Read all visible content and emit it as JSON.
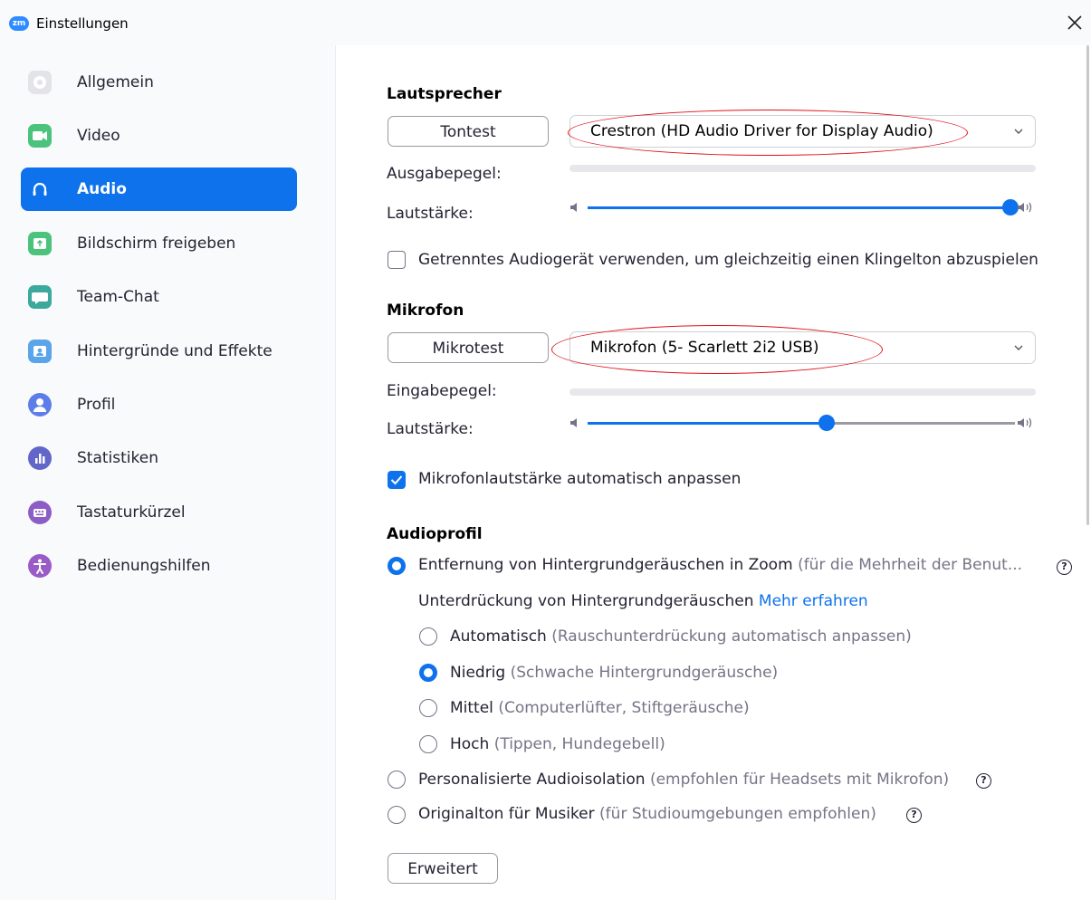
{
  "window": {
    "logo_text": "zm",
    "title": "Einstellungen"
  },
  "sidebar": {
    "items": [
      {
        "label": "Allgemein",
        "icon": "gear-icon",
        "color": "#e4e4e8"
      },
      {
        "label": "Video",
        "icon": "video-camera-icon",
        "color": "#4cc37c"
      },
      {
        "label": "Audio",
        "icon": "headphones-icon",
        "color": "#0e72ed",
        "active": true
      },
      {
        "label": "Bildschirm freigeben",
        "icon": "share-screen-icon",
        "color": "#4cc37c"
      },
      {
        "label": "Team-Chat",
        "icon": "chat-bubble-icon",
        "color": "#3ba99c"
      },
      {
        "label": "Hintergründe und Effekte",
        "icon": "background-person-icon",
        "color": "#5aa4ea"
      },
      {
        "label": "Profil",
        "icon": "profile-icon",
        "color": "#5d7ee8"
      },
      {
        "label": "Statistiken",
        "icon": "statistics-icon",
        "color": "#6266c9"
      },
      {
        "label": "Tastaturkürzel",
        "icon": "keyboard-icon",
        "color": "#8d5dc6"
      },
      {
        "label": "Bedienungshilfen",
        "icon": "accessibility-icon",
        "color": "#9a5bc6"
      }
    ]
  },
  "speaker": {
    "title": "Lautsprecher",
    "test_button": "Tontest",
    "device": "Crestron (HD Audio Driver for Display Audio)",
    "output_level_label": "Ausgabepegel:",
    "volume_label": "Lautstärke:",
    "volume": 0.99
  },
  "separate_device": {
    "label": "Getrenntes Audiogerät verwenden, um gleichzeitig einen Klingelton abzuspielen",
    "checked": false
  },
  "microphone": {
    "title": "Mikrofon",
    "test_button": "Mikrotest",
    "device": "Mikrofon (5- Scarlett 2i2 USB)",
    "input_level_label": "Eingabepegel:",
    "volume_label": "Lautstärke:",
    "volume": 0.56
  },
  "auto_adjust": {
    "label": "Mikrofonlautstärke automatisch anpassen",
    "checked": true
  },
  "audio_profile": {
    "title": "Audioprofil",
    "zoom_removal": {
      "label": "Entfernung von Hintergrundgeräuschen in Zoom",
      "hint": "(für die Mehrheit der Benut...",
      "selected": true
    },
    "suppression_label": "Unterdrückung von Hintergrundgeräuschen",
    "learn_more": "Mehr erfahren",
    "levels": [
      {
        "label": "Automatisch",
        "hint": "(Rauschunterdrückung automatisch anpassen)",
        "selected": false
      },
      {
        "label": "Niedrig",
        "hint": "(Schwache Hintergrundgeräusche)",
        "selected": true
      },
      {
        "label": "Mittel",
        "hint": "(Computerlüfter, Stiftgeräusche)",
        "selected": false
      },
      {
        "label": "Hoch",
        "hint": "(Tippen, Hundegebell)",
        "selected": false
      }
    ],
    "personalized": {
      "label": "Personalisierte Audioisolation",
      "hint": "(empfohlen für Headsets mit Mikrofon)",
      "selected": false
    },
    "original_sound": {
      "label": "Originalton für Musiker",
      "hint": "(für Studioumgebungen empfohlen)",
      "selected": false
    },
    "help_glyph": "?"
  },
  "advanced_button": "Erweitert",
  "close_glyph": "✕",
  "colors": {
    "accent": "#0e72ed",
    "annotation": "#e0131b",
    "sidebar_bg": "#f9fafb"
  }
}
